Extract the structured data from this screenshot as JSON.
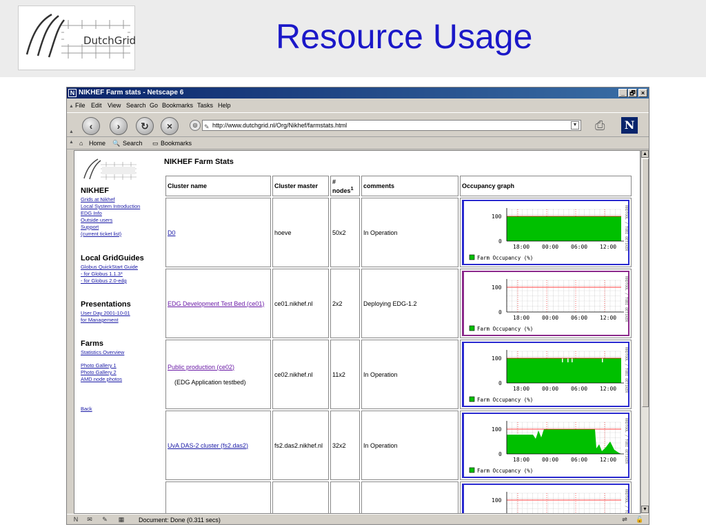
{
  "slide": {
    "title": "Resource Usage",
    "logo_text": "DutchGrid"
  },
  "browser": {
    "window_title": "NIKHEF Farm stats - Netscape 6",
    "win_buttons": {
      "minimize": "_",
      "maximize": "🗗",
      "close": "×"
    },
    "menu": [
      "File",
      "Edit",
      "View",
      "Search",
      "Go",
      "Bookmarks",
      "Tasks",
      "Help"
    ],
    "url": "http://www.dutchgrid.nl/Org/Nikhef/farmstats.html",
    "personal_toolbar": {
      "home": "Home",
      "search": "Search",
      "bookmarks": "Bookmarks"
    },
    "status": "Document: Done (0.311 secs)",
    "icons": [
      "back-icon",
      "forward-icon",
      "reload-icon",
      "stop-icon",
      "search-go-icon",
      "print-icon",
      "netscape-icon"
    ]
  },
  "sidebar": {
    "sections": [
      {
        "heading": "NIKHEF",
        "links": [
          "Grids at Nikhef",
          "Local System Introduction",
          "EDG Info",
          "Outside users",
          "Support",
          "(current ticket list)"
        ]
      },
      {
        "heading": "Local GridGuides",
        "links": [
          "Globus QuickStart Guide",
          "- for Globus 1.1.3*",
          "- for Globus 2.0-edg"
        ]
      },
      {
        "heading": "Presentations",
        "links": [
          "User Day 2001-10-01",
          "for Management"
        ]
      },
      {
        "heading": "Farms",
        "links": [
          "Statistics Overview",
          "Photo Gallery 1",
          "Photo Gallery 2",
          "AMD node photos"
        ]
      }
    ],
    "back": "Back"
  },
  "page": {
    "title": "NIKHEF Farm Stats",
    "columns": [
      "Cluster name",
      "Cluster master",
      "# nodes",
      "comments",
      "Occupancy graph"
    ],
    "nodes_footnote": "1",
    "rows": [
      {
        "name": "D0",
        "note": "",
        "master": "hoeve",
        "nodes": "50x2",
        "comment": "In Operation"
      },
      {
        "name": "EDG Development Test Bed (ce01)",
        "note": "",
        "master": "ce01.nikhef.nl",
        "nodes": "2x2",
        "comment": "Deploying EDG-1.2"
      },
      {
        "name": "Public production (ce02)",
        "note": "(EDG Application testbed)",
        "master": "ce02.nikhef.nl",
        "nodes": "11x2",
        "comment": "In Operation"
      },
      {
        "name": "UvA DAS-2 cluster (fs2.das2)",
        "note": "",
        "master": "fs2.das2.nikhef.nl",
        "nodes": "32x2",
        "comment": "In Operation"
      }
    ],
    "graph": {
      "legend": "Farm Occupancy (%)",
      "y_ticks": [
        "100",
        "0"
      ],
      "x_ticks": [
        "18:00",
        "00:00",
        "06:00",
        "12:00"
      ],
      "side_label": "RRDTOOL / TOBI OETIKER",
      "colors": {
        "fill": "#00c000",
        "grid": "#c0c0c0",
        "max": "#ff0000"
      }
    },
    "partial_row_y_tick": "100"
  }
}
